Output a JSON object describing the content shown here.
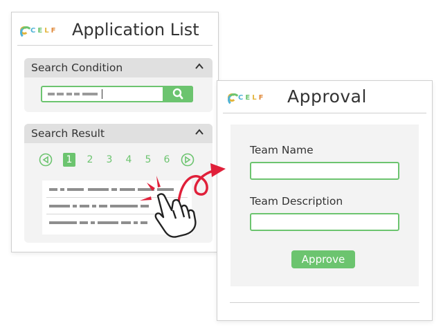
{
  "colors": {
    "accent": "#6cc46f",
    "arrow": "#e0203a",
    "panel_bg": "#f3f3f3",
    "panel_header": "#e0e0e0"
  },
  "logo": {
    "letters": [
      "C",
      "E",
      "L",
      "F"
    ],
    "letter_colors": [
      "#4fb3d6",
      "#6cc46f",
      "#e3b53c",
      "#e08a3c"
    ]
  },
  "application_list": {
    "title": "Application List",
    "search_condition": {
      "header": "Search Condition",
      "search_icon": "magnifier-icon"
    },
    "search_result": {
      "header": "Search Result",
      "pages": [
        "1",
        "2",
        "3",
        "4",
        "5",
        "6"
      ],
      "active_page": "1",
      "prev_icon": "circle-left-triangle-icon",
      "next_icon": "circle-right-triangle-icon"
    }
  },
  "approval": {
    "title": "Approval",
    "team_name_label": "Team Name",
    "team_description_label": "Team Description",
    "approve_label": "Approve"
  },
  "overlay_icons": [
    "pointing-hand-icon",
    "curved-arrow-icon"
  ]
}
